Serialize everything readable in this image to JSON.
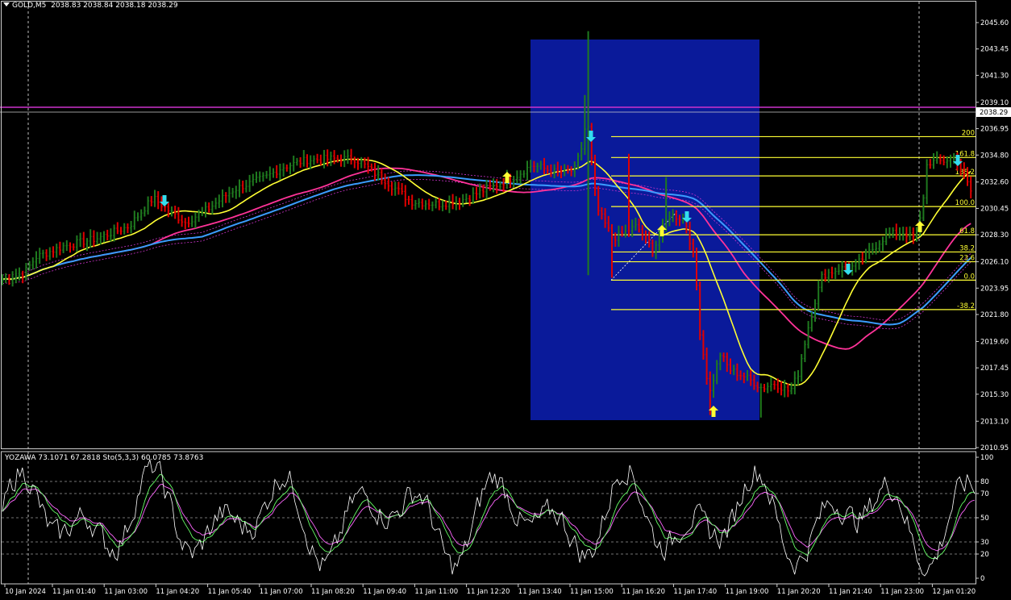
{
  "header": {
    "symbol": "GOLD,M5",
    "ohlc": "2038.83 2038.84 2038.18 2038.29"
  },
  "indicator_header": {
    "text": "YOZAWA 73.1071 67.2818  Sto(5,3,3) 60.0785 73.8763"
  },
  "price_axis": {
    "ticks": [
      "2045.60",
      "2043.45",
      "2041.30",
      "2039.10",
      "2036.95",
      "2034.80",
      "2032.60",
      "2030.45",
      "2028.30",
      "2026.10",
      "2023.95",
      "2021.80",
      "2019.60",
      "2017.45",
      "2015.30",
      "2013.10",
      "2010.95"
    ],
    "current_price": "2038.29"
  },
  "osc_axis": {
    "ticks": [
      "100",
      "80",
      "70",
      "50",
      "30",
      "20",
      "0"
    ]
  },
  "time_axis": {
    "ticks": [
      "10 Jan 2024",
      "11 Jan 01:40",
      "11 Jan 03:00",
      "11 Jan 04:20",
      "11 Jan 05:40",
      "11 Jan 07:00",
      "11 Jan 08:20",
      "11 Jan 09:40",
      "11 Jan 11:00",
      "11 Jan 12:20",
      "11 Jan 13:40",
      "11 Jan 15:00",
      "11 Jan 16:20",
      "11 Jan 17:40",
      "11 Jan 19:00",
      "11 Jan 20:20",
      "11 Jan 21:40",
      "11 Jan 23:00",
      "12 Jan 01:20"
    ]
  },
  "fibonacci": {
    "levels": [
      "200",
      "161.8",
      "138.2",
      "100.0",
      "61.8",
      "38.2",
      "23.6",
      "0.0",
      "-38.2"
    ],
    "prices": [
      2036.3,
      2034.6,
      2033.1,
      2030.6,
      2028.3,
      2026.9,
      2026.1,
      2024.6,
      2022.2
    ]
  },
  "colors": {
    "bull": "#1f7a1f",
    "bear": "#e00000",
    "fast_ma": "#ffff33",
    "slow_ma": "#3b9cff",
    "mid_ma": "#ff3399",
    "fib": "#ffff33",
    "zone": "#0a1a9a",
    "resistance": "#cc33cc",
    "buy_arrow": "#ffff33",
    "sell_arrow": "#33ddee"
  }
}
